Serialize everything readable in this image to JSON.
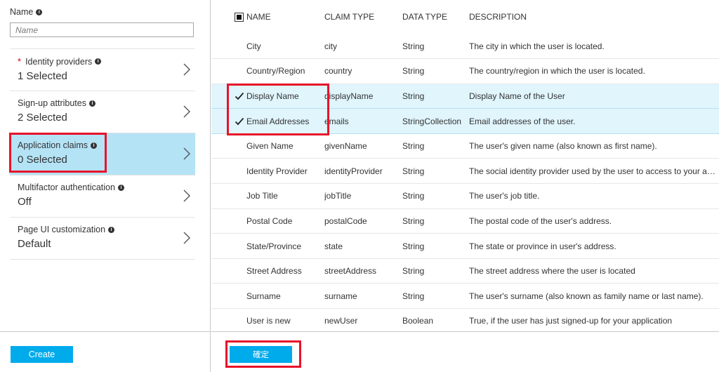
{
  "left": {
    "name_label": "Name",
    "name_placeholder": "Name",
    "menu": [
      {
        "label": "Identity providers",
        "value": "1 Selected",
        "required": true
      },
      {
        "label": "Sign-up attributes",
        "value": "2 Selected"
      },
      {
        "label": "Application claims",
        "value": "0 Selected",
        "active": true
      },
      {
        "label": "Multifactor authentication",
        "value": "Off"
      },
      {
        "label": "Page UI customization",
        "value": "Default"
      }
    ],
    "create_label": "Create"
  },
  "table": {
    "headers": [
      "NAME",
      "CLAIM TYPE",
      "DATA TYPE",
      "DESCRIPTION"
    ],
    "rows": [
      {
        "name": "City",
        "claim_type": "city",
        "data_type": "String",
        "description": "The city in which the user is located.",
        "checked": false
      },
      {
        "name": "Country/Region",
        "claim_type": "country",
        "data_type": "String",
        "description": "The country/region in which the user is located.",
        "checked": false
      },
      {
        "name": "Display Name",
        "claim_type": "displayName",
        "data_type": "String",
        "description": "Display Name of the User",
        "checked": true
      },
      {
        "name": "Email Addresses",
        "claim_type": "emails",
        "data_type": "StringCollection",
        "description": "Email addresses of the user.",
        "checked": true
      },
      {
        "name": "Given Name",
        "claim_type": "givenName",
        "data_type": "String",
        "description": "The user's given name (also known as first name).",
        "checked": false
      },
      {
        "name": "Identity Provider",
        "claim_type": "identityProvider",
        "data_type": "String",
        "description": "The social identity provider used by the user to access to your application.",
        "checked": false
      },
      {
        "name": "Job Title",
        "claim_type": "jobTitle",
        "data_type": "String",
        "description": "The user's job title.",
        "checked": false
      },
      {
        "name": "Postal Code",
        "claim_type": "postalCode",
        "data_type": "String",
        "description": "The postal code of the user's address.",
        "checked": false
      },
      {
        "name": "State/Province",
        "claim_type": "state",
        "data_type": "String",
        "description": "The state or province in user's address.",
        "checked": false
      },
      {
        "name": "Street Address",
        "claim_type": "streetAddress",
        "data_type": "String",
        "description": "The street address where the user is located",
        "checked": false
      },
      {
        "name": "Surname",
        "claim_type": "surname",
        "data_type": "String",
        "description": "The user's surname (also known as family name or last name).",
        "checked": false
      },
      {
        "name": "User is new",
        "claim_type": "newUser",
        "data_type": "Boolean",
        "description": "True, if the user has just signed-up for your application",
        "checked": false
      }
    ]
  },
  "ok_label": "確定",
  "colors": {
    "accent": "#00abec",
    "selected_menu": "#b4e3f6",
    "selected_row": "#e0f5fc",
    "highlight": "#e8132a"
  },
  "icons": {
    "info": "info-icon",
    "chevron": "chevron-right-icon",
    "check": "checkmark-icon"
  }
}
